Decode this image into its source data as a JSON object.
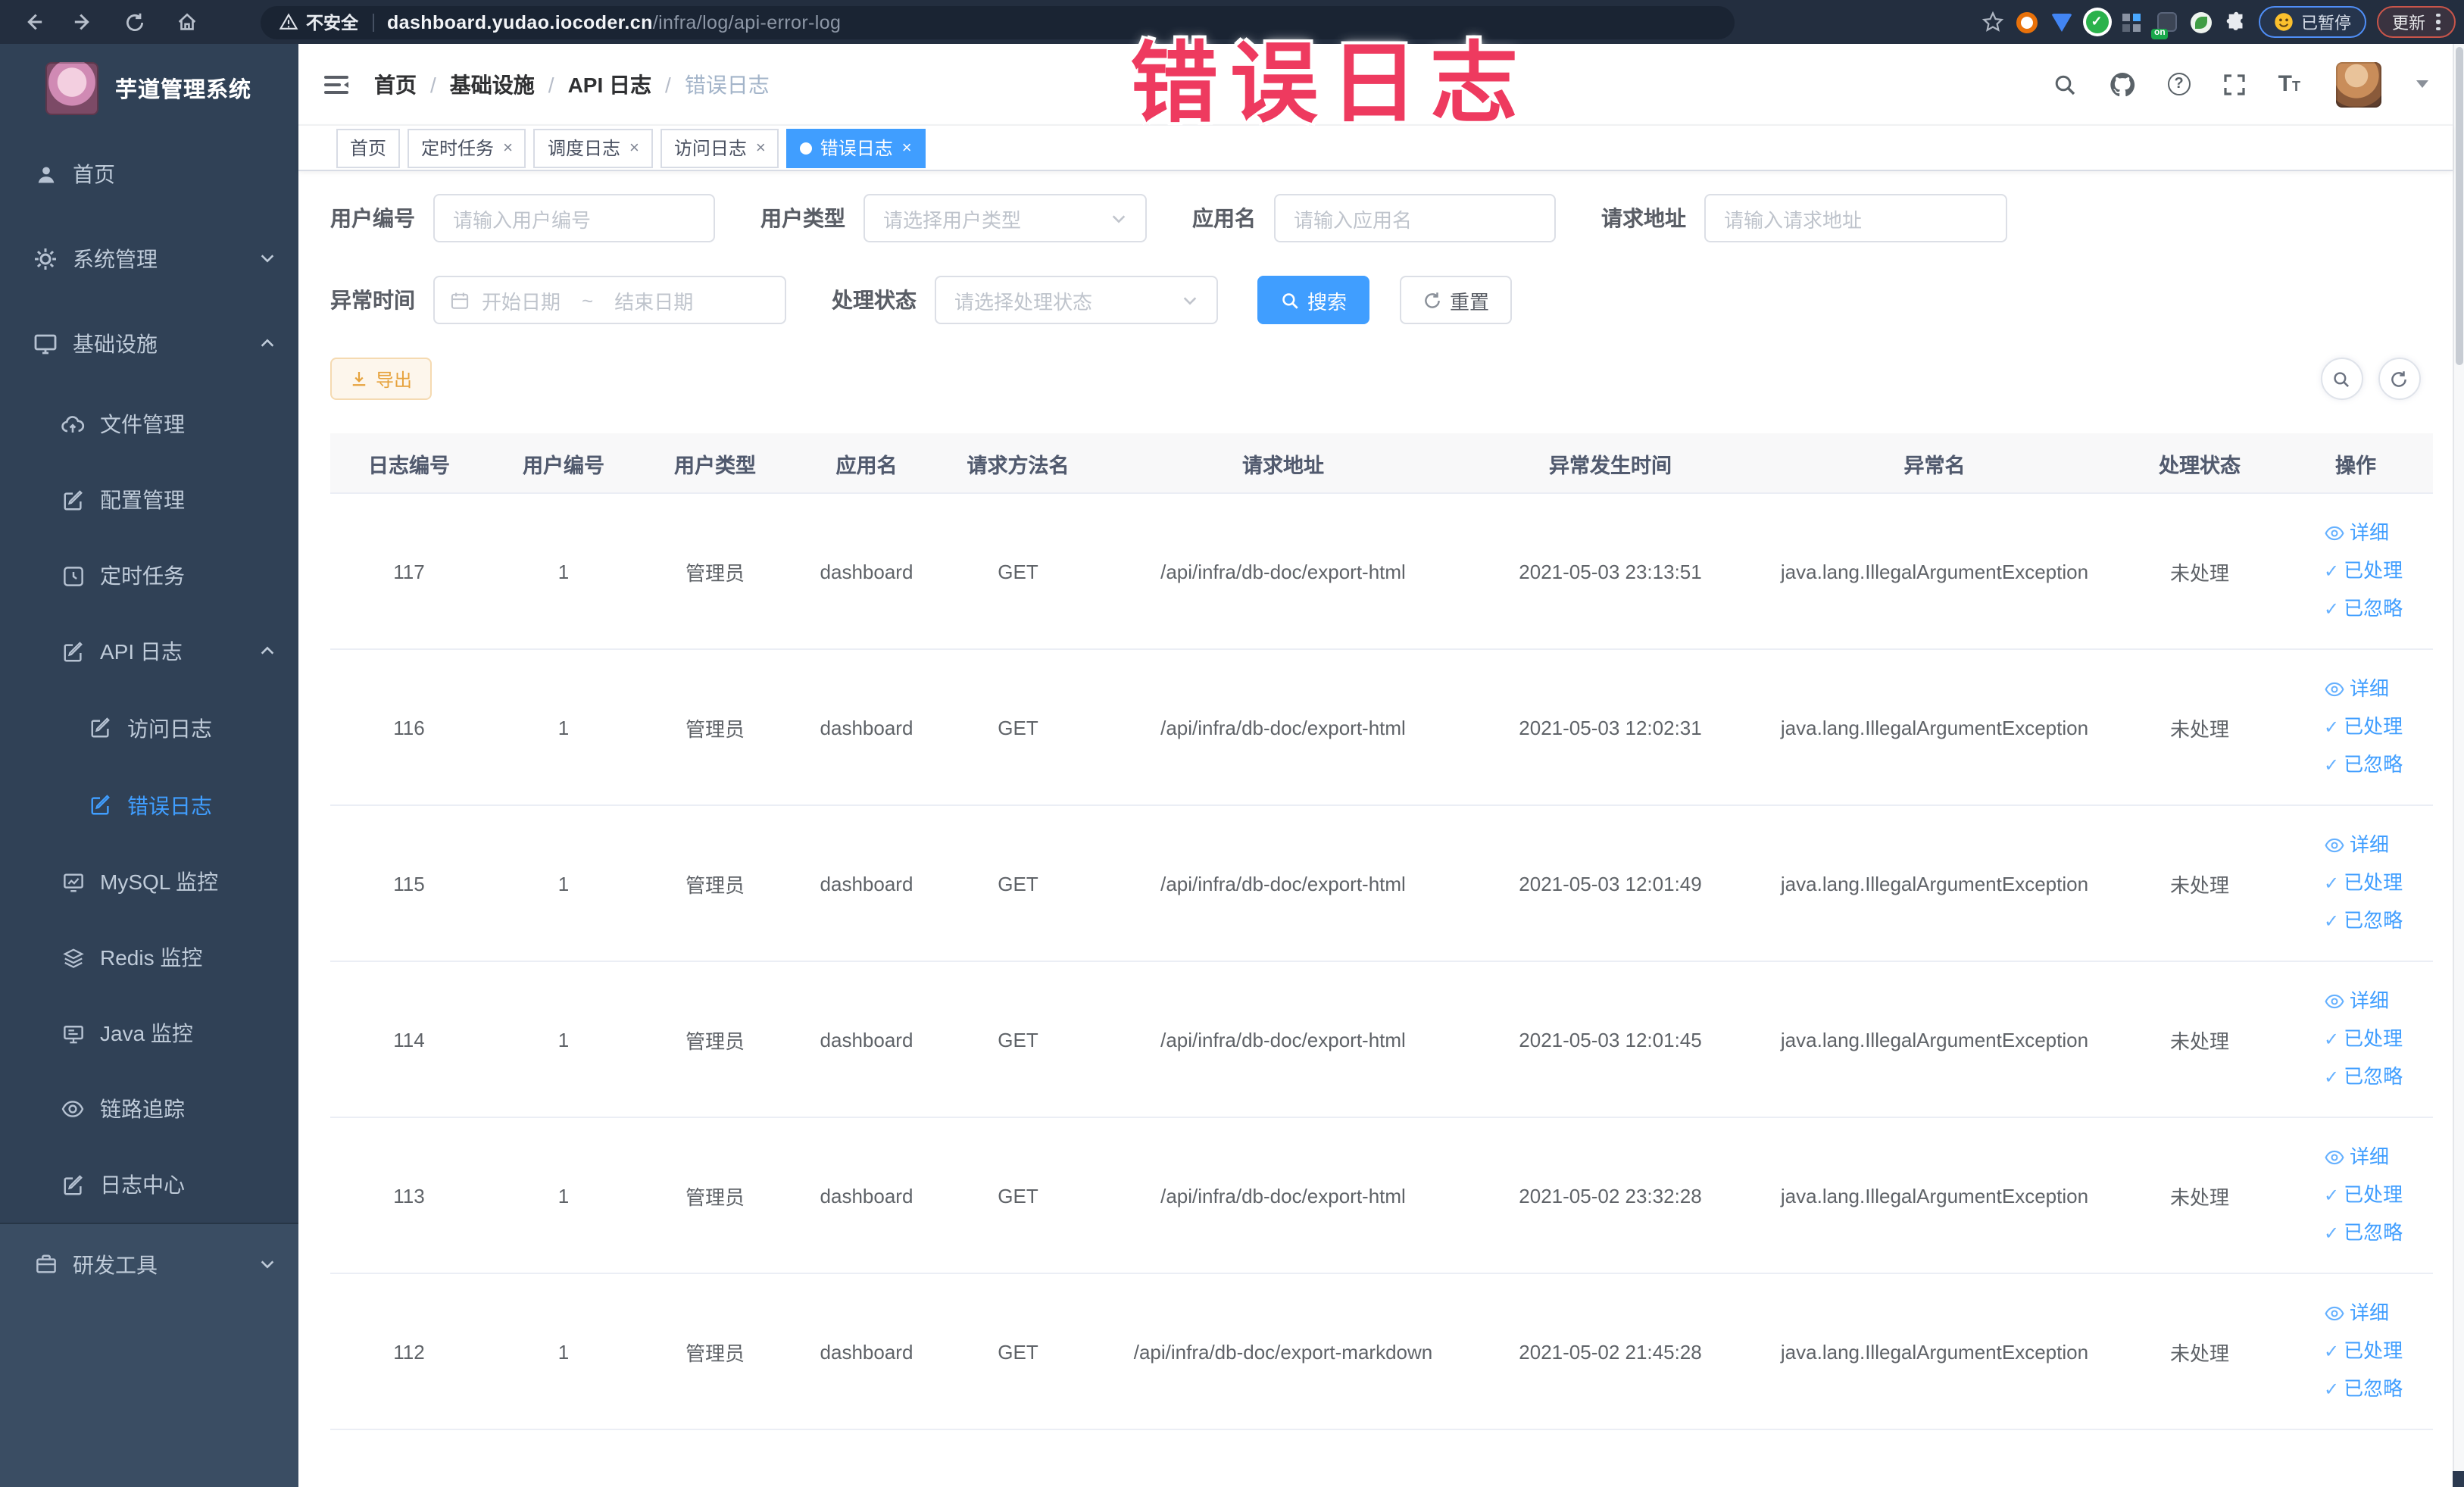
{
  "browser": {
    "security_label": "不安全",
    "url_domain": "dashboard.yudao.iocoder.cn",
    "url_path": "/infra/log/api-error-log",
    "extension_badge": "on",
    "paused_badge": "已暂停",
    "update_button": "更新"
  },
  "annotation": {
    "text": "错误日志",
    "color": "#ee3a5f"
  },
  "sidebar": {
    "title": "芋道管理系统",
    "items": [
      {
        "label": "首页"
      },
      {
        "label": "系统管理"
      },
      {
        "label": "基础设施"
      },
      {
        "label": "文件管理"
      },
      {
        "label": "配置管理"
      },
      {
        "label": "定时任务"
      },
      {
        "label": "API 日志"
      },
      {
        "label": "访问日志"
      },
      {
        "label": "错误日志"
      },
      {
        "label": "MySQL 监控"
      },
      {
        "label": "Redis 监控"
      },
      {
        "label": "Java 监控"
      },
      {
        "label": "链路追踪"
      },
      {
        "label": "日志中心"
      },
      {
        "label": "研发工具"
      }
    ]
  },
  "breadcrumb": {
    "items": [
      "首页",
      "基础设施",
      "API 日志",
      "错误日志"
    ]
  },
  "tabs": [
    {
      "label": "首页",
      "closable": false,
      "active": false
    },
    {
      "label": "定时任务",
      "closable": true,
      "active": false
    },
    {
      "label": "调度日志",
      "closable": true,
      "active": false
    },
    {
      "label": "访问日志",
      "closable": true,
      "active": false
    },
    {
      "label": "错误日志",
      "closable": true,
      "active": true
    }
  ],
  "filters": {
    "user_id_label": "用户编号",
    "user_id_placeholder": "请输入用户编号",
    "user_type_label": "用户类型",
    "user_type_placeholder": "请选择用户类型",
    "app_name_label": "应用名",
    "app_name_placeholder": "请输入应用名",
    "request_url_label": "请求地址",
    "request_url_placeholder": "请输入请求地址",
    "exception_time_label": "异常时间",
    "date_start_placeholder": "开始日期",
    "date_separator": "~",
    "date_end_placeholder": "结束日期",
    "process_status_label": "处理状态",
    "process_status_placeholder": "请选择处理状态",
    "search_button": "搜索",
    "reset_button": "重置"
  },
  "toolbar_actions": {
    "export_button": "导出"
  },
  "table": {
    "columns": [
      "日志编号",
      "用户编号",
      "用户类型",
      "应用名",
      "请求方法名",
      "请求地址",
      "异常发生时间",
      "异常名",
      "处理状态",
      "操作"
    ],
    "row_actions": [
      "详细",
      "已处理",
      "已忽略"
    ],
    "rows": [
      {
        "log_id": "117",
        "user_id": "1",
        "user_type": "管理员",
        "app_name": "dashboard",
        "method": "GET",
        "url": "/api/infra/db-doc/export-html",
        "time": "2021-05-03 23:13:51",
        "exception": "java.lang.IllegalArgumentException",
        "status": "未处理"
      },
      {
        "log_id": "116",
        "user_id": "1",
        "user_type": "管理员",
        "app_name": "dashboard",
        "method": "GET",
        "url": "/api/infra/db-doc/export-html",
        "time": "2021-05-03 12:02:31",
        "exception": "java.lang.IllegalArgumentException",
        "status": "未处理"
      },
      {
        "log_id": "115",
        "user_id": "1",
        "user_type": "管理员",
        "app_name": "dashboard",
        "method": "GET",
        "url": "/api/infra/db-doc/export-html",
        "time": "2021-05-03 12:01:49",
        "exception": "java.lang.IllegalArgumentException",
        "status": "未处理"
      },
      {
        "log_id": "114",
        "user_id": "1",
        "user_type": "管理员",
        "app_name": "dashboard",
        "method": "GET",
        "url": "/api/infra/db-doc/export-html",
        "time": "2021-05-03 12:01:45",
        "exception": "java.lang.IllegalArgumentException",
        "status": "未处理"
      },
      {
        "log_id": "113",
        "user_id": "1",
        "user_type": "管理员",
        "app_name": "dashboard",
        "method": "GET",
        "url": "/api/infra/db-doc/export-html",
        "time": "2021-05-02 23:32:28",
        "exception": "java.lang.IllegalArgumentException",
        "status": "未处理"
      },
      {
        "log_id": "112",
        "user_id": "1",
        "user_type": "管理员",
        "app_name": "dashboard",
        "method": "GET",
        "url": "/api/infra/db-doc/export-markdown",
        "time": "2021-05-02 21:45:28",
        "exception": "java.lang.IllegalArgumentException",
        "status": "未处理"
      }
    ]
  },
  "icons": {
    "browser": [
      "back-icon",
      "forward-icon",
      "reload-icon",
      "home-icon",
      "warning-icon",
      "bookmark-star-icon",
      "extensions-puzzle-icon",
      "kebab-menu-icon"
    ],
    "navbar": [
      "search-icon",
      "github-icon",
      "help-icon",
      "fullscreen-icon",
      "font-size-icon",
      "chevron-down-icon"
    ],
    "actions": [
      "eye-icon",
      "check-icon",
      "download-icon",
      "refresh-icon",
      "calendar-icon"
    ]
  },
  "colors": {
    "primary": "#409eff",
    "sidebar_bg": "#304156",
    "toolbar_bg": "#232e3f",
    "warning_btn": "#e6a23c",
    "annotation": "#ee3a5f"
  }
}
